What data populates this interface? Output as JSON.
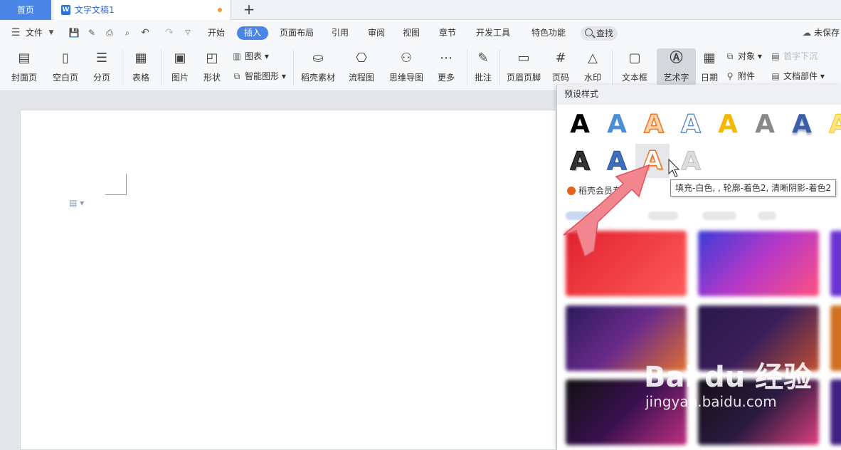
{
  "tabs": {
    "home": "首页",
    "doc": "文字文稿1",
    "new": "+"
  },
  "menu": {
    "file": "文件",
    "items": [
      "开始",
      "插入",
      "页面布局",
      "引用",
      "审阅",
      "视图",
      "章节",
      "开发工具",
      "特色功能"
    ],
    "search": "查找",
    "unsaved": "未保存"
  },
  "ribbon": {
    "cover": "封面页",
    "blank": "空白页",
    "pagebreak": "分页",
    "table": "表格",
    "picture": "图片",
    "shape": "形状",
    "chart": "图表",
    "smartart": "智能图形",
    "material": "稻壳素材",
    "flowchart": "流程图",
    "mindmap": "思维导图",
    "more": "更多",
    "comment": "批注",
    "header_footer": "页眉页脚",
    "page_number": "页码",
    "watermark": "水印",
    "textbox": "文本框",
    "wordart": "艺术字",
    "date": "日期",
    "object": "对象",
    "attachment": "附件",
    "dropcap": "首字下沉",
    "docparts": "文档部件"
  },
  "panel": {
    "title": "预设样式",
    "sample_letter": "A",
    "vip": "稻壳会员专享"
  },
  "tooltip": "填充-白色, , 轮廓-着色2, 清晰阴影-着色2",
  "watermark": {
    "logo": "Bai du 经验",
    "url": "jingyan.baidu.com"
  },
  "colors": {
    "accent": "#4a86e8",
    "orange": "#f0903a",
    "arrow": "#f2868f"
  }
}
